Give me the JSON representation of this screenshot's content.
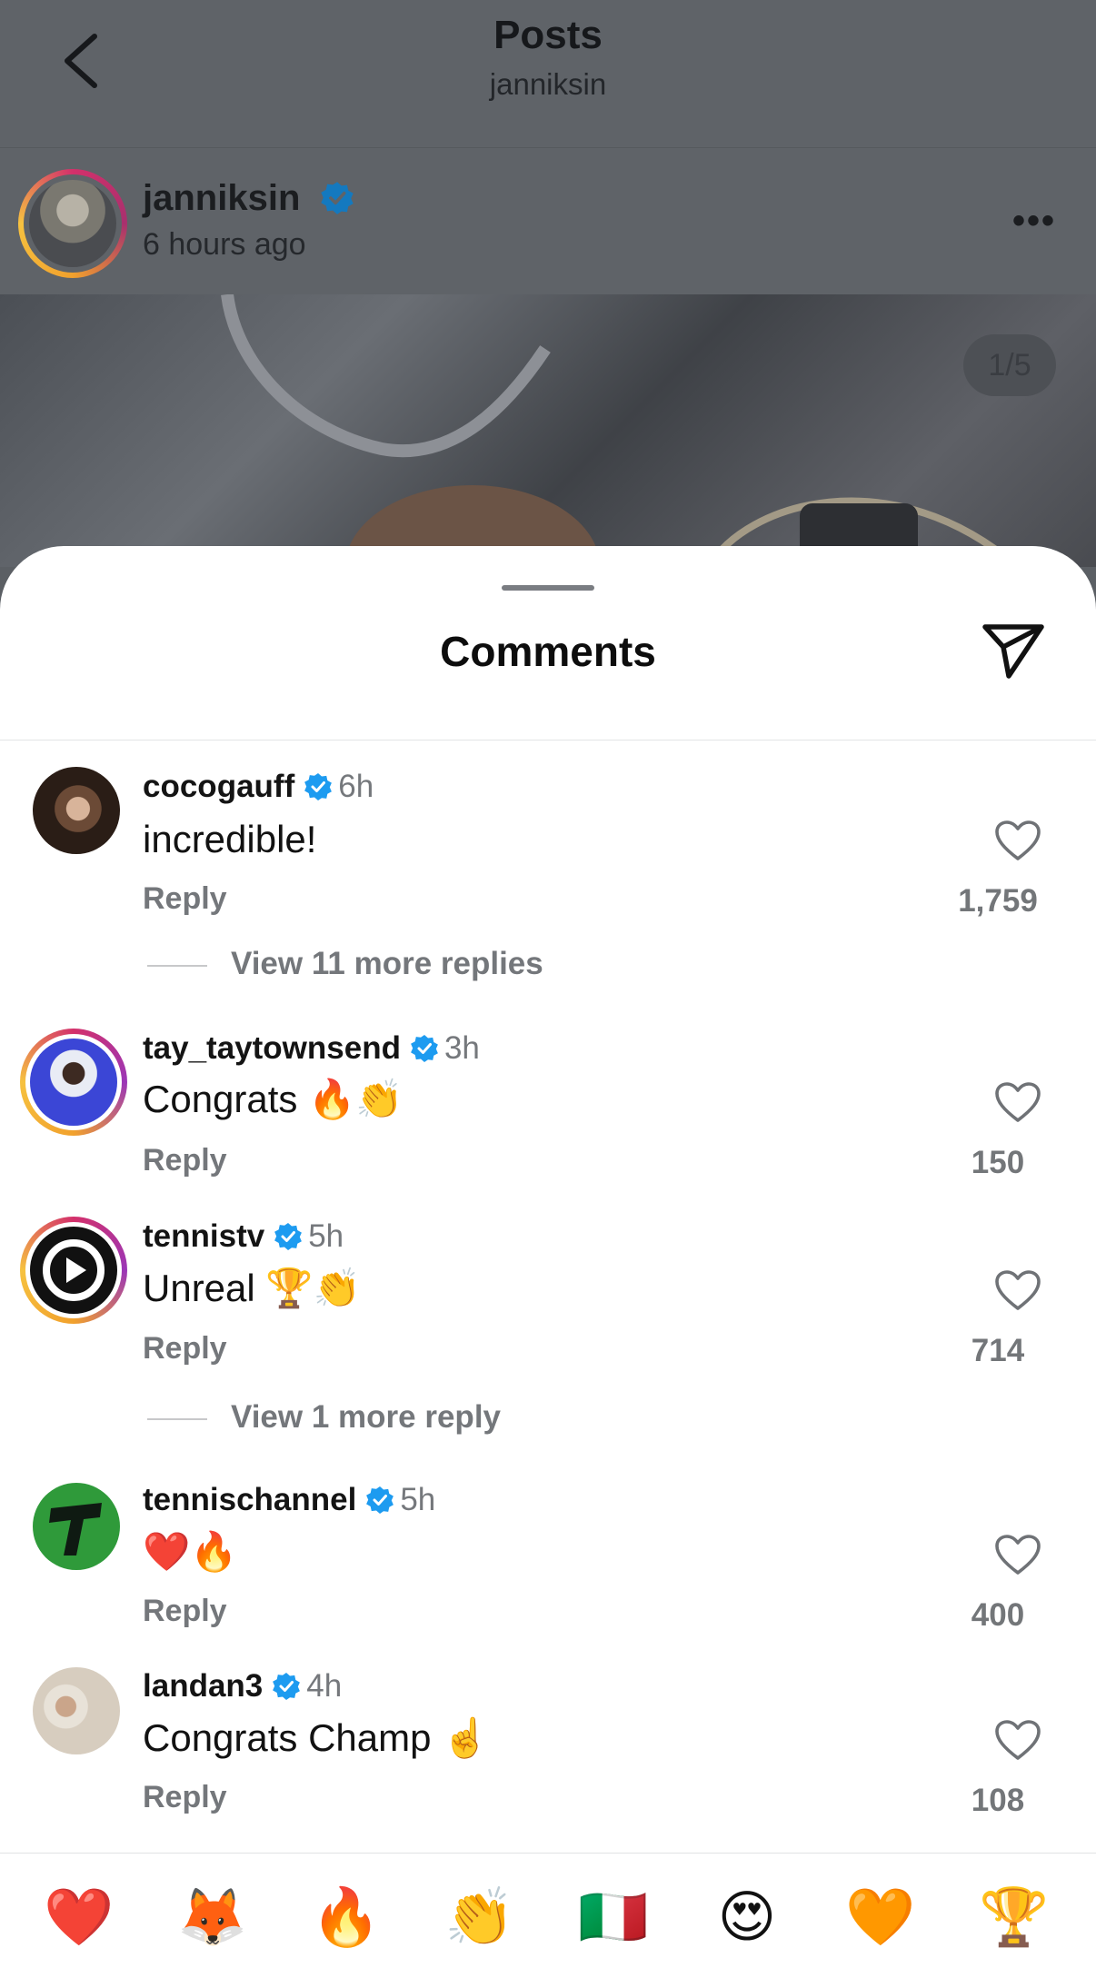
{
  "nav": {
    "title": "Posts",
    "subtitle": "janniksin"
  },
  "post": {
    "author": "janniksin",
    "time": "6 hours ago",
    "image_counter": "1/5"
  },
  "sheet": {
    "title": "Comments"
  },
  "comments": [
    {
      "username": "cocogauff",
      "time": "6h",
      "text": "incredible!",
      "reply_label": "Reply",
      "likes": "1,759",
      "view_more": "View 11 more replies"
    },
    {
      "username": "tay_taytownsend",
      "time": "3h",
      "text": "Congrats 🔥👏",
      "reply_label": "Reply",
      "likes": "150"
    },
    {
      "username": "tennistv",
      "time": "5h",
      "text": "Unreal 🏆👏",
      "reply_label": "Reply",
      "likes": "714",
      "view_more": "View 1 more reply"
    },
    {
      "username": "tennischannel",
      "time": "5h",
      "text": "❤️🔥",
      "reply_label": "Reply",
      "likes": "400"
    },
    {
      "username": "landan3",
      "time": "4h",
      "text": "Congrats Champ ☝️",
      "reply_label": "Reply",
      "likes": "108"
    }
  ],
  "quick_reactions": [
    "❤️",
    "🦊",
    "🔥",
    "👏",
    "🇮🇹",
    "😍",
    "🧡",
    "🏆"
  ],
  "colors": {
    "verified": "#1d9bf0",
    "secondary_text": "#75787c",
    "story_ring_start": "#d3306b",
    "story_ring_end": "#f6c240"
  },
  "icons": {
    "back": "chevron-left-icon",
    "more": "more-horizontal-icon",
    "send": "send-icon",
    "like": "heart-outline-icon",
    "verified": "verified-badge-icon"
  }
}
